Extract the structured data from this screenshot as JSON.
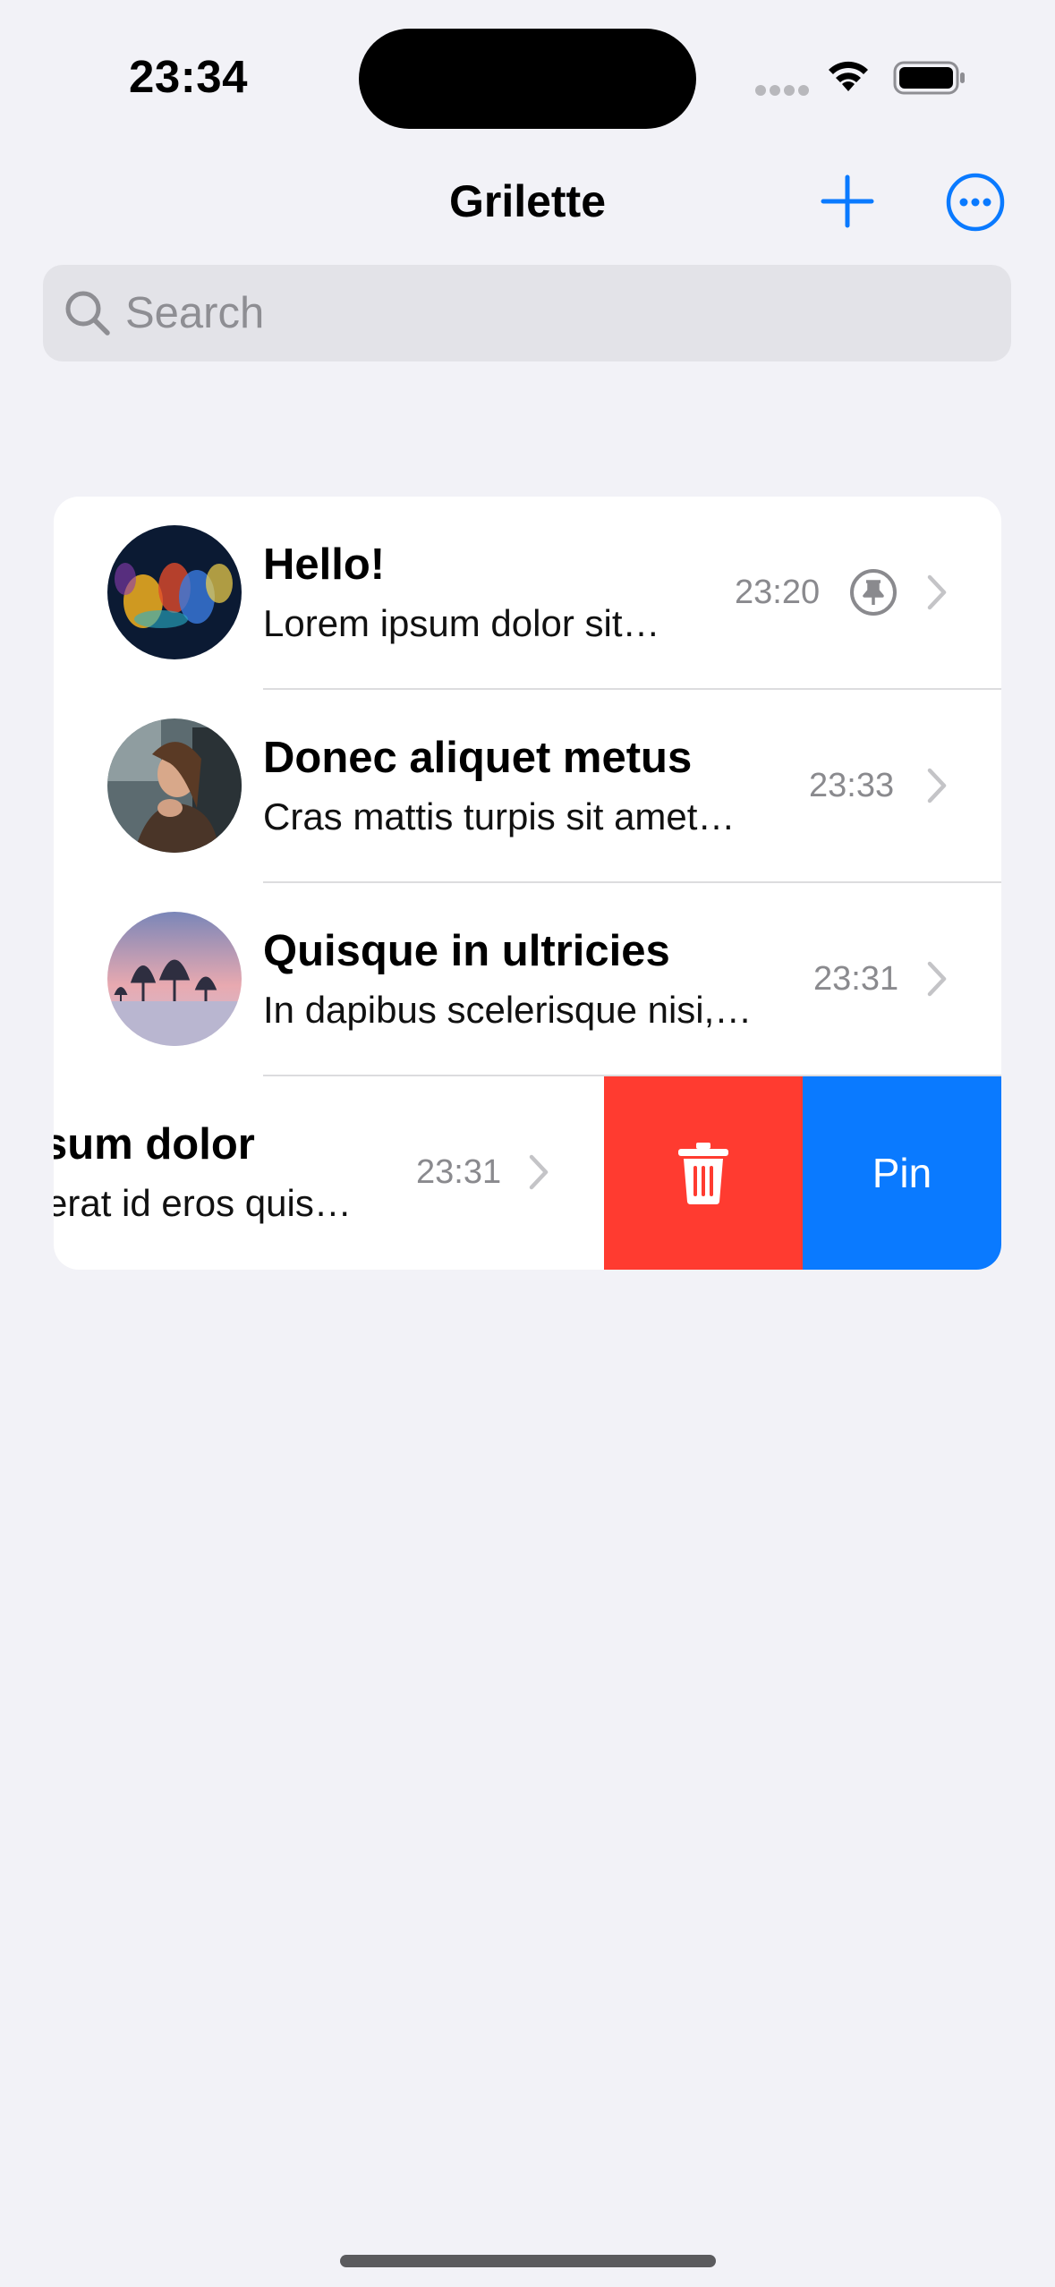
{
  "status_bar": {
    "time": "23:34"
  },
  "nav": {
    "title": "Grilette"
  },
  "search": {
    "placeholder": "Search"
  },
  "colors": {
    "accent": "#0a7aff",
    "destructive": "#ff3b30",
    "background": "#f2f2f7"
  },
  "conversations": [
    {
      "title": "Hello!",
      "preview": "Lorem ipsum dolor sit…",
      "time": "23:20",
      "pinned": true
    },
    {
      "title": "Donec aliquet metus",
      "preview": "Cras mattis turpis sit amet…",
      "time": "23:33",
      "pinned": false
    },
    {
      "title": "Quisque in ultricies",
      "preview": "In dapibus scelerisque nisi,…",
      "time": "23:31",
      "pinned": false
    },
    {
      "title": "sum dolor",
      "preview": "erat id eros quis…",
      "time": "23:31",
      "pinned": false
    }
  ],
  "swipe_actions": {
    "delete_icon": "trash-icon",
    "pin_label": "Pin"
  }
}
